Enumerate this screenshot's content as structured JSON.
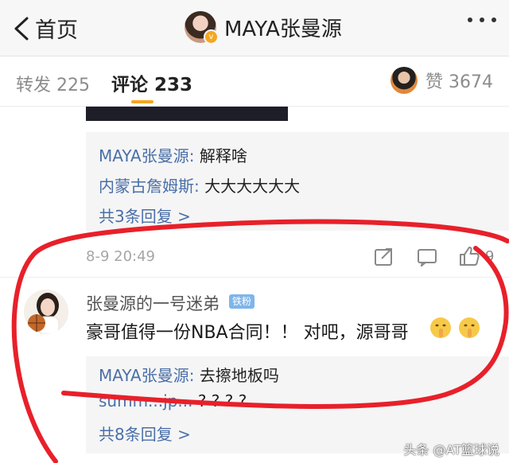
{
  "header": {
    "back_label": "首页",
    "title": "MAYA张曼源"
  },
  "tabs": {
    "repost": {
      "label": "转发",
      "count": "225"
    },
    "comments": {
      "label": "评论",
      "count": "233"
    },
    "likes": {
      "label": "赞",
      "count": "3674"
    }
  },
  "first_comment": {
    "replies": [
      {
        "user": "MAYA张曼源:",
        "text": " 解释啥"
      },
      {
        "user": "内蒙古詹姆斯:",
        "text": " 大大大大大大"
      }
    ],
    "more_replies": "共3条回复 >",
    "time": "8-9 20:49",
    "like_count": "9"
  },
  "second_comment": {
    "user": "张曼源的一号迷弟",
    "badge": "铁粉",
    "text": "豪哥值得一份NBA合同！！ 对吧，源哥哥",
    "replies": [
      {
        "user": "MAYA张曼源:",
        "text": " 去擦地板吗"
      },
      {
        "user": "summ...jp...",
        "text": " ?  ?  ?  ?"
      }
    ],
    "more_replies": "共8条回复 >"
  },
  "watermark": "头条 @AT篮球说",
  "colors": {
    "accent": "#f5a623",
    "link": "#4a6fa8",
    "annotation": "#e8202a"
  }
}
